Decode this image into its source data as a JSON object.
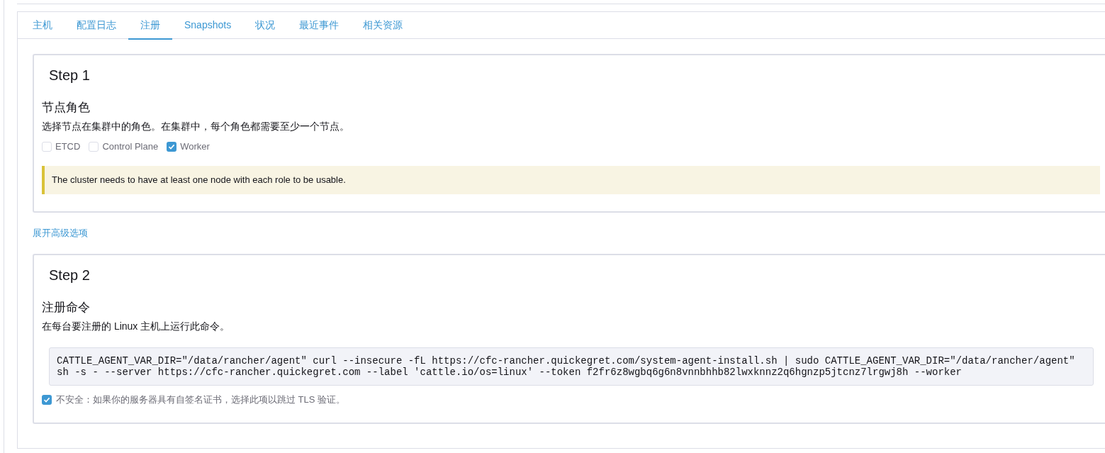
{
  "tabs": [
    {
      "label": "主机",
      "selected": false
    },
    {
      "label": "配置日志",
      "selected": false
    },
    {
      "label": "注册",
      "selected": true
    },
    {
      "label": "Snapshots",
      "selected": false
    },
    {
      "label": "状况",
      "selected": false
    },
    {
      "label": "最近事件",
      "selected": false
    },
    {
      "label": "相关资源",
      "selected": false
    }
  ],
  "step1": {
    "title": "Step 1",
    "heading": "节点角色",
    "description": "选择节点在集群中的角色。在集群中，每个角色都需要至少一个节点。",
    "roles": [
      {
        "label": "ETCD",
        "checked": false
      },
      {
        "label": "Control Plane",
        "checked": false
      },
      {
        "label": "Worker",
        "checked": true
      }
    ],
    "banner": "The cluster needs to have at least one node with each role to be usable."
  },
  "advanced_link": "展开高级选项",
  "step2": {
    "title": "Step 2",
    "heading": "注册命令",
    "description": "在每台要注册的 Linux 主机上运行此命令。",
    "command_lines": [
      "CATTLE_AGENT_VAR_DIR=\"/data/rancher/agent\" curl --insecure -fL https://cfc-rancher.quickegret.com/system-agent-install.sh | sudo CATTLE_AGENT_VAR_DIR=\"/data/rancher/agent\"",
      "sh -s - --server https://cfc-rancher.quickegret.com --label 'cattle.io/os=linux' --token f2fr6z8wgbq6g6n8vnnbhhb82lwxknnz2q6hgnzp5jtcnz7lrgwj8h --worker"
    ],
    "insecure": {
      "label": "不安全：如果你的服务器具有自签名证书，选择此项以跳过 TLS 验证。",
      "checked": true
    }
  }
}
